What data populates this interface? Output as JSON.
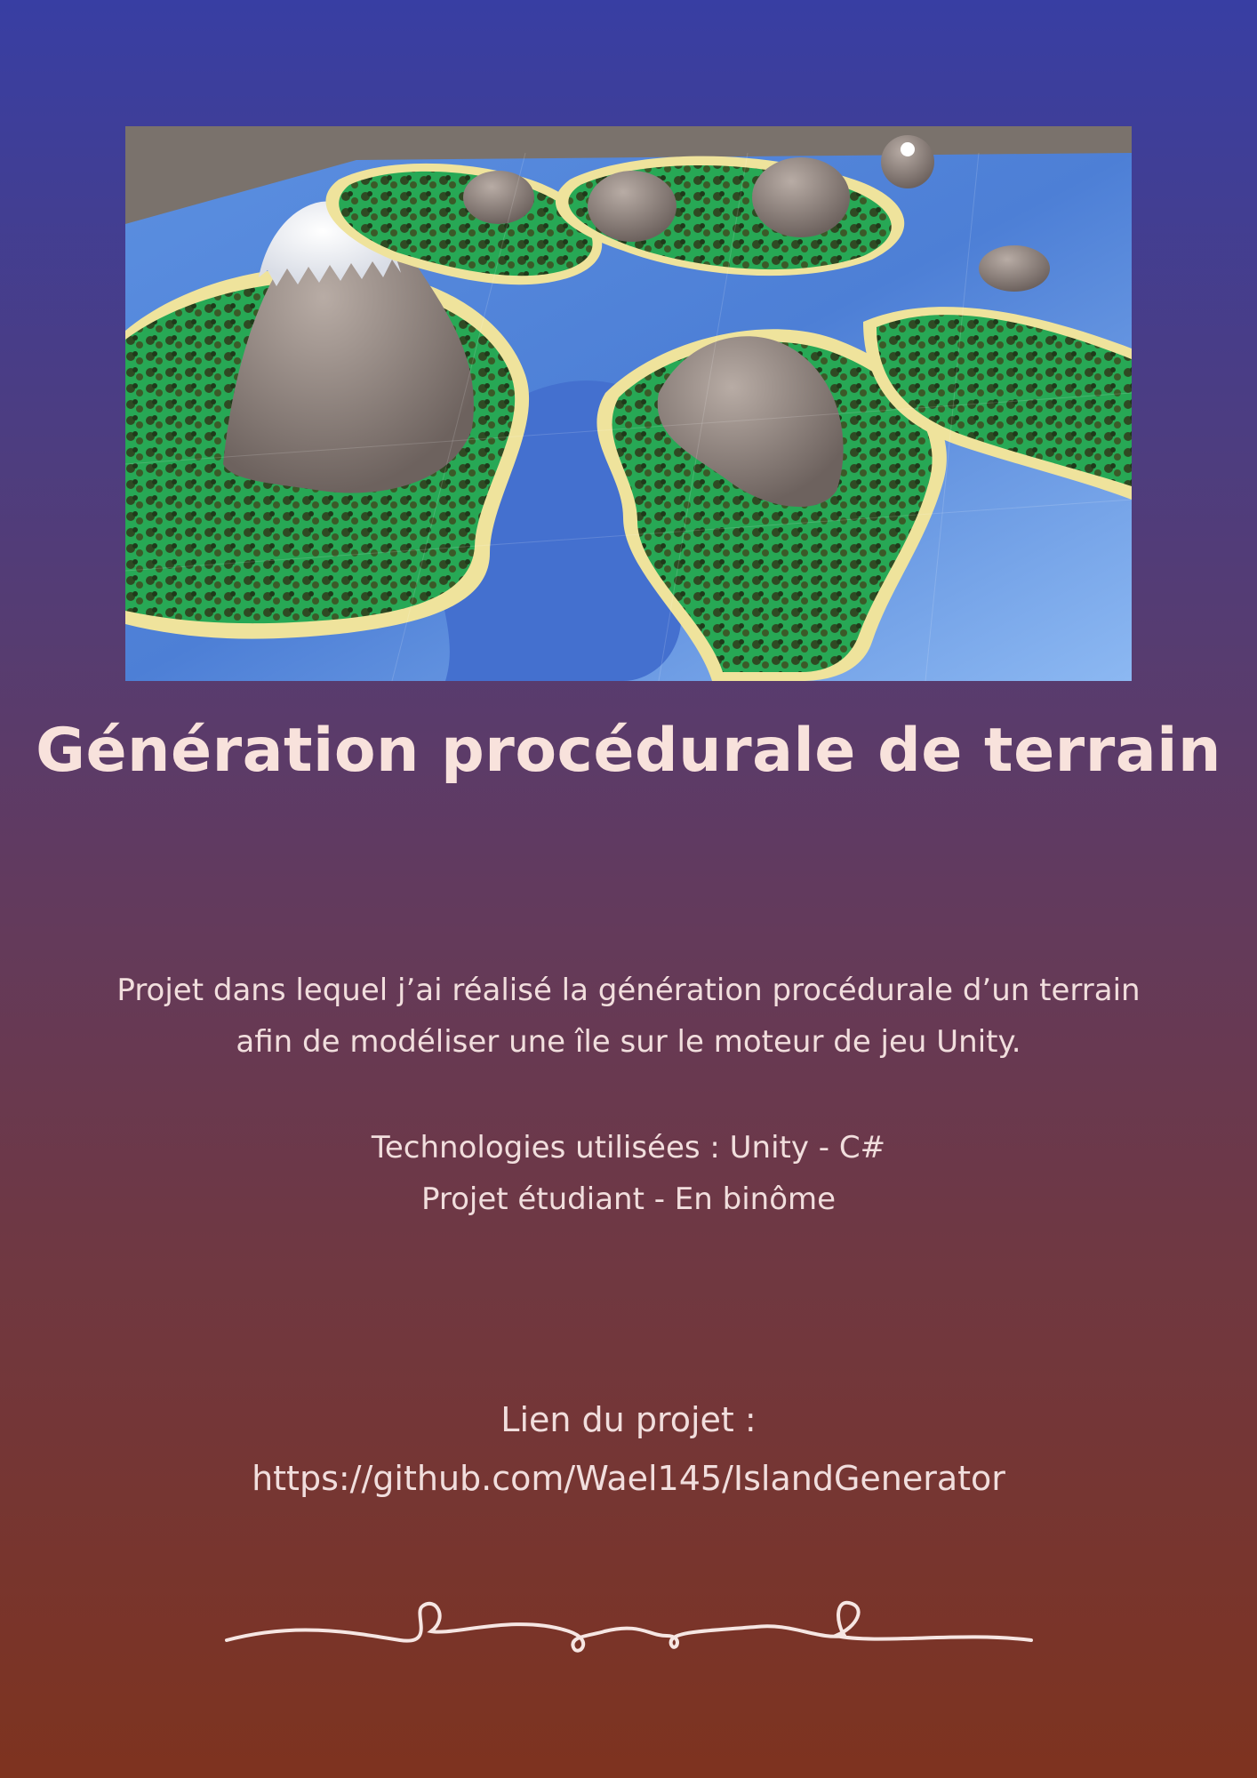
{
  "title": "Génération procédurale de terrain",
  "description": "Projet dans lequel j’ai réalisé la génération procédurale d’un terrain afin de modéliser une île sur le moteur de jeu Unity.",
  "technologies": "Technologies utilisées : Unity - C#",
  "project_type": "Projet étudiant - En binôme",
  "link": {
    "label": "Lien du projet :",
    "url": "https://github.com/Wael145/IslandGenerator"
  },
  "colors": {
    "background_top": "#383ea3",
    "background_bottom": "#7e331f",
    "text": "#f6e6e3"
  }
}
